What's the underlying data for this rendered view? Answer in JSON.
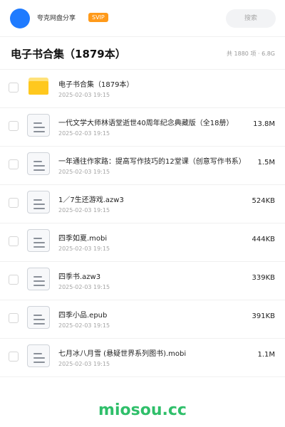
{
  "topbar": {
    "share_title": "夸克网盘分享",
    "badge": "SVIP",
    "search_placeholder": "搜索"
  },
  "header": {
    "title": "电子书合集（1879本）",
    "summary": "共 1880 项 · 6.8G"
  },
  "files": [
    {
      "type": "folder",
      "name": "电子书合集（1879本）",
      "date": "2025-02-03 19:15",
      "size": ""
    },
    {
      "type": "file",
      "name": "一代文学大师林语堂逝世40周年纪念典藏版（全18册）",
      "date": "2025-02-03 19:15",
      "size": "13.8M"
    },
    {
      "type": "file",
      "name": "一年通往作家路：提高写作技巧的12堂课（创意写作书系）",
      "date": "2025-02-03 19:15",
      "size": "1.5M"
    },
    {
      "type": "file",
      "name": "1／7生还游戏.azw3",
      "date": "2025-02-03 19:15",
      "size": "524KB"
    },
    {
      "type": "file",
      "name": "四季如夏.mobi",
      "date": "2025-02-03 19:15",
      "size": "444KB"
    },
    {
      "type": "file",
      "name": "四季书.azw3",
      "date": "2025-02-03 19:15",
      "size": "339KB"
    },
    {
      "type": "file",
      "name": "四季小品.epub",
      "date": "2025-02-03 19:15",
      "size": "391KB"
    },
    {
      "type": "file",
      "name": "七月冰八月雪 (悬疑世界系列图书).mobi",
      "date": "2025-02-03 19:15",
      "size": "1.1M"
    }
  ],
  "watermark": "miosou.cc",
  "colors": {
    "avatar": "#1f7bff",
    "svip_badge": "#ff9a1a",
    "folder": "#ffc81e",
    "watermark": "#2fbf6a"
  }
}
